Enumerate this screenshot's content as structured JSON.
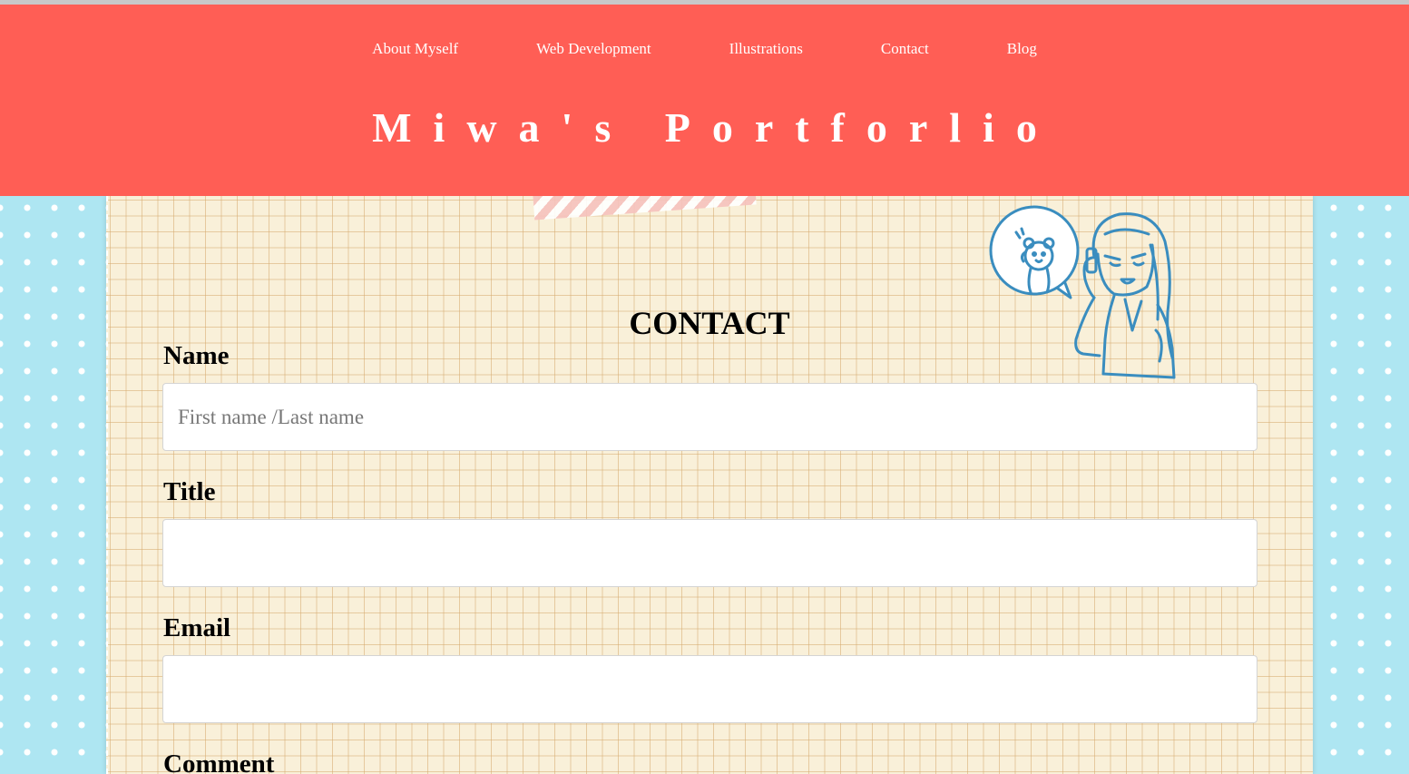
{
  "nav": {
    "items": [
      {
        "label": "About Myself"
      },
      {
        "label": "Web Development"
      },
      {
        "label": "Illustrations"
      },
      {
        "label": "Contact"
      },
      {
        "label": "Blog"
      }
    ]
  },
  "header": {
    "title": "Miwa's Portforlio",
    "background_color": "#ff5e55"
  },
  "contact": {
    "heading": "CONTACT",
    "fields": {
      "name": {
        "label": "Name",
        "placeholder": "First name /Last name",
        "value": ""
      },
      "title": {
        "label": "Title",
        "placeholder": "",
        "value": ""
      },
      "email": {
        "label": "Email",
        "placeholder": "",
        "value": ""
      },
      "comment": {
        "label": "Comment"
      }
    },
    "illustration": {
      "icon": "girl-on-phone-with-bear-icon"
    }
  },
  "colors": {
    "accent": "#ff5e55",
    "side_background": "#aee6f2",
    "paper": "#f9f0d9"
  }
}
